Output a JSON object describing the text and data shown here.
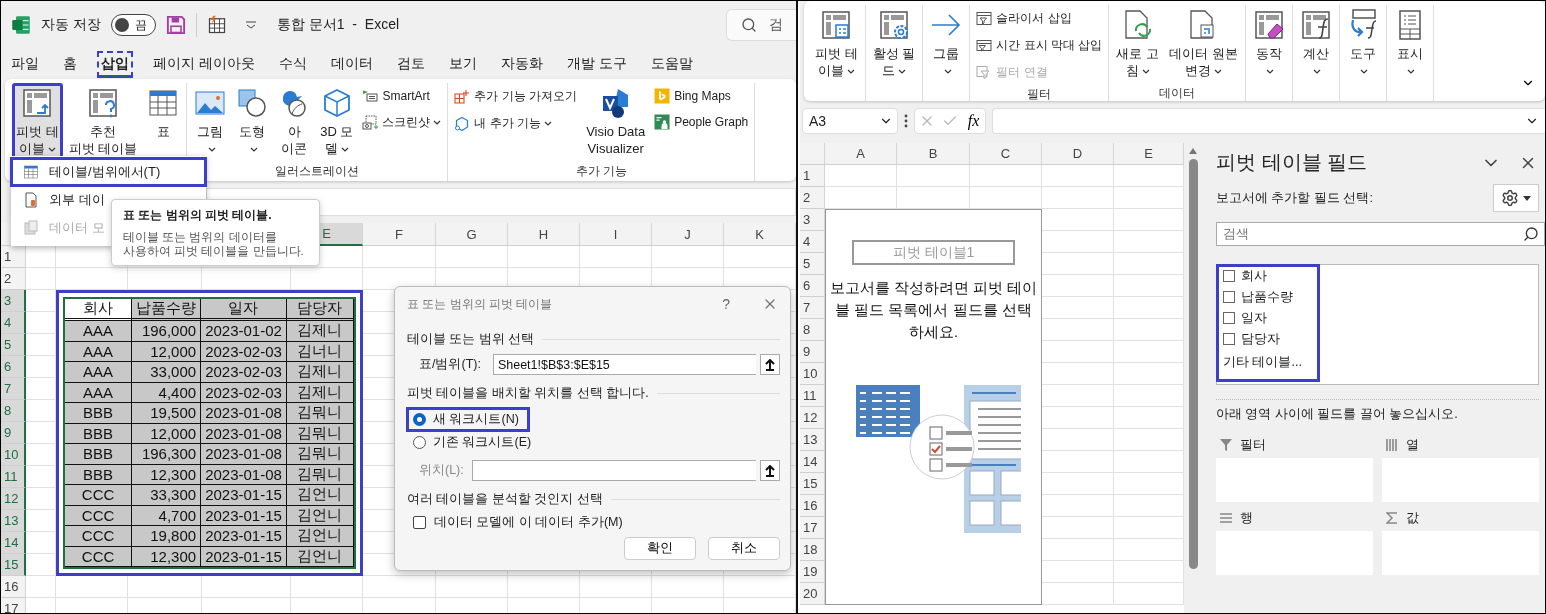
{
  "left_window": {
    "title_bar": {
      "autosave_label": "자동 저장",
      "autosave_toggle": {
        "label": "끔",
        "on": false
      },
      "title": "통합 문서1  -  Excel",
      "search": {
        "placeholder": "검"
      }
    },
    "menu_tabs": [
      {
        "label": "파일",
        "selected": false,
        "highlighted": false
      },
      {
        "label": "홈",
        "selected": false,
        "highlighted": false
      },
      {
        "label": "삽입",
        "selected": true,
        "highlighted": true
      },
      {
        "label": "페이지 레이아웃",
        "selected": false,
        "highlighted": false
      },
      {
        "label": "수식",
        "selected": false,
        "highlighted": false
      },
      {
        "label": "데이터",
        "selected": false,
        "highlighted": false
      },
      {
        "label": "검토",
        "selected": false,
        "highlighted": false
      },
      {
        "label": "보기",
        "selected": false,
        "highlighted": false
      },
      {
        "label": "자동화",
        "selected": false,
        "highlighted": false
      },
      {
        "label": "개발 도구",
        "selected": false,
        "highlighted": false
      },
      {
        "label": "도움말",
        "selected": false,
        "highlighted": false
      }
    ],
    "ribbon": {
      "groups": [
        {
          "items": [
            {
              "kind": "large",
              "lines": [
                "피벗 테",
                "이블"
              ],
              "dropdown": true,
              "pressed": true,
              "highlighted": true
            },
            {
              "kind": "large",
              "lines": [
                "추천",
                "피벗 테이블"
              ],
              "dropdown": false,
              "pressed": false,
              "highlighted": false
            },
            {
              "kind": "large",
              "lines": [
                "표"
              ],
              "dropdown": false,
              "pressed": false,
              "highlighted": false
            }
          ]
        },
        {
          "label": "일러스트레이션",
          "items": [
            {
              "kind": "large",
              "lines": [
                "그림"
              ],
              "dropdown": true,
              "pressed": false,
              "highlighted": false
            },
            {
              "kind": "large",
              "lines": [
                "도형"
              ],
              "dropdown": true,
              "pressed": false,
              "highlighted": false
            },
            {
              "kind": "large",
              "lines": [
                "아",
                "이콘"
              ],
              "dropdown": false,
              "pressed": false,
              "highlighted": false
            },
            {
              "kind": "large",
              "lines": [
                "3D 모",
                "델"
              ],
              "dropdown": true,
              "pressed": false,
              "highlighted": false
            },
            {
              "kind": "small",
              "lines": [
                "SmartArt"
              ],
              "dropdown": false,
              "pressed": false,
              "highlighted": false
            },
            {
              "kind": "small",
              "lines": [
                "스크린샷"
              ],
              "dropdown": true,
              "pressed": false,
              "highlighted": false
            }
          ]
        },
        {
          "label": "추가 기능",
          "items": [
            {
              "kind": "small",
              "lines": [
                "추가 기능 가져오기"
              ],
              "dropdown": false,
              "pressed": false,
              "highlighted": false
            },
            {
              "kind": "small",
              "lines": [
                "내 추가 기능"
              ],
              "dropdown": true,
              "pressed": false,
              "highlighted": false
            },
            {
              "kind": "large",
              "lines": [
                "Visio Data",
                "Visualizer"
              ],
              "dropdown": false,
              "pressed": false,
              "highlighted": false
            },
            {
              "kind": "small",
              "lines": [
                "Bing Maps"
              ],
              "dropdown": false,
              "pressed": false,
              "highlighted": false
            },
            {
              "kind": "small",
              "lines": [
                "People Graph"
              ],
              "dropdown": false,
              "pressed": false,
              "highlighted": false
            }
          ]
        }
      ]
    },
    "dropdown_menu": {
      "items": [
        {
          "label": "테이블/범위에서(T)",
          "disabled": false,
          "highlighted": true
        },
        {
          "label": "외부 데이",
          "disabled": false,
          "highlighted": false
        },
        {
          "label": "데이터 모",
          "disabled": true,
          "highlighted": false
        }
      ]
    },
    "tooltip": {
      "title": "표 또는 범위의 피벗 테이블.",
      "body_lines": [
        "테이블 또는 범위의 데이터를",
        "사용하여 피벗 테이블을 만듭니다."
      ]
    },
    "sheet": {
      "column_headers": [
        "E",
        "F",
        "G",
        "H",
        "I",
        "J",
        "K"
      ],
      "row_headers": [
        "1",
        "2",
        "3",
        "4",
        "5",
        "6",
        "7",
        "8",
        "9",
        "10",
        "11",
        "12",
        "13",
        "14",
        "15",
        "16",
        "17"
      ],
      "table": {
        "highlighted": true,
        "columns": [
          {
            "label": "회사",
            "active": true
          },
          {
            "label": "납품수량",
            "active": false
          },
          {
            "label": "일자",
            "active": false
          },
          {
            "label": "담당자",
            "active": false
          }
        ],
        "rows": [
          [
            "AAA",
            "196,000",
            "2023-01-02",
            "김제니"
          ],
          [
            "AAA",
            "12,000",
            "2023-02-03",
            "김너니"
          ],
          [
            "AAA",
            "33,000",
            "2023-02-03",
            "김제니"
          ],
          [
            "AAA",
            "4,400",
            "2023-02-03",
            "김제니"
          ],
          [
            "BBB",
            "19,500",
            "2023-01-08",
            "김뭐니"
          ],
          [
            "BBB",
            "12,000",
            "2023-01-08",
            "김뭐니"
          ],
          [
            "BBB",
            "196,300",
            "2023-01-08",
            "김뭐니"
          ],
          [
            "BBB",
            "12,300",
            "2023-01-08",
            "김뭐니"
          ],
          [
            "CCC",
            "33,300",
            "2023-01-15",
            "김언니"
          ],
          [
            "CCC",
            "4,700",
            "2023-01-15",
            "김언니"
          ],
          [
            "CCC",
            "19,800",
            "2023-01-15",
            "김언니"
          ],
          [
            "CCC",
            "12,300",
            "2023-01-15",
            "김언니"
          ]
        ]
      }
    },
    "dialog": {
      "title": "표 또는 범위의 피벗 테이블",
      "help_label": "?",
      "sections": [
        {
          "heading": "테이블 또는 범위 선택"
        },
        {
          "heading": "피벗 테이블을 배치할 위치를 선택 합니다."
        },
        {
          "heading": "여러 테이블을 분석할 것인지 선택"
        }
      ],
      "range_field": {
        "label": "표/범위(T):",
        "value": "Sheet1!$B$3:$E$15"
      },
      "placement_options": [
        {
          "label": "새 워크시트(N)",
          "selected": true,
          "highlighted": true
        },
        {
          "label": "기존 워크시트(E)",
          "selected": false,
          "highlighted": false
        }
      ],
      "location_field": {
        "label": "위치(L):",
        "disabled": true
      },
      "data_model_checkbox": {
        "label": "데이터 모델에 이 데이터 추가(M)",
        "checked": false
      },
      "buttons": [
        "확인",
        "취소"
      ]
    }
  },
  "right_window": {
    "ribbon": {
      "groups": [
        {
          "items": [
            {
              "kind": "large",
              "lines": [
                "피벗 테",
                "이블"
              ],
              "dropdown": true
            }
          ]
        },
        {
          "items": [
            {
              "kind": "large",
              "lines": [
                "활성 필",
                "드"
              ],
              "dropdown": true
            }
          ]
        },
        {
          "items": [
            {
              "kind": "large",
              "lines": [
                "그룹"
              ],
              "dropdown": true
            }
          ]
        },
        {
          "label": "필터",
          "items": [
            {
              "kind": "small",
              "lines": [
                "슬라이서 삽입"
              ],
              "dropdown": false,
              "disabled": false
            },
            {
              "kind": "small",
              "lines": [
                "시간 표시 막대 삽입"
              ],
              "dropdown": false,
              "disabled": false
            },
            {
              "kind": "small",
              "lines": [
                "필터 연결"
              ],
              "dropdown": false,
              "disabled": true
            }
          ]
        },
        {
          "label": "데이터",
          "items": [
            {
              "kind": "large",
              "lines": [
                "새로 고",
                "침"
              ],
              "dropdown": true
            },
            {
              "kind": "large",
              "lines": [
                "데이터 원본",
                "변경"
              ],
              "dropdown": true
            }
          ]
        },
        {
          "items": [
            {
              "kind": "large",
              "lines": [
                "동작"
              ],
              "dropdown": true
            }
          ]
        },
        {
          "items": [
            {
              "kind": "large",
              "lines": [
                "계산"
              ],
              "dropdown": true
            }
          ]
        },
        {
          "items": [
            {
              "kind": "large",
              "lines": [
                "도구"
              ],
              "dropdown": true
            }
          ]
        },
        {
          "items": [
            {
              "kind": "large",
              "lines": [
                "표시"
              ],
              "dropdown": true
            }
          ]
        }
      ]
    },
    "formula_bar": {
      "name_box": "A3",
      "function_label": "fx"
    },
    "sheet": {
      "column_headers": [
        "A",
        "B",
        "C",
        "D",
        "E"
      ],
      "row_headers": [
        "1",
        "2",
        "3",
        "4",
        "5",
        "6",
        "7",
        "8",
        "9",
        "10",
        "11",
        "12",
        "13",
        "14",
        "15",
        "16",
        "17",
        "18",
        "19",
        "20"
      ],
      "pivot_placeholder": {
        "title": "피벗 테이블1",
        "instructions": "보고서를 작성하려면 피벗 테이블 필드 목록에서 필드를 선택하세요."
      }
    },
    "field_pane": {
      "title": "피벗 테이블 필드",
      "subtitle": "보고서에 추가할 필드 선택:",
      "search": {
        "placeholder": "검색"
      },
      "field_list": {
        "highlighted": true,
        "fields": [
          {
            "label": "회사",
            "checked": false
          },
          {
            "label": "납품수량",
            "checked": false
          },
          {
            "label": "일자",
            "checked": false
          },
          {
            "label": "담당자",
            "checked": false
          }
        ],
        "more_link": "기타 테이블..."
      },
      "drag_hint": "아래 영역 사이에 필드를 끌어 놓으십시오.",
      "areas": [
        {
          "label": "필터"
        },
        {
          "label": "열"
        },
        {
          "label": "행"
        },
        {
          "label": "값"
        }
      ]
    }
  }
}
